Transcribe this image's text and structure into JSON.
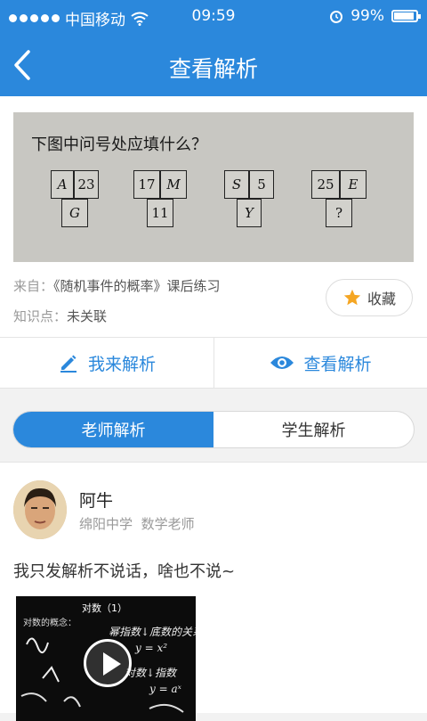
{
  "status": {
    "carrier": "中国移动",
    "time": "09:59",
    "battery": "99%"
  },
  "header": {
    "title": "查看解析"
  },
  "question": {
    "prompt": "下图中问号处应填什么？",
    "puzzles": [
      {
        "tl": "A",
        "tr": "23",
        "b": "G"
      },
      {
        "tl": "17",
        "tr": "M",
        "b": "11"
      },
      {
        "tl": "S",
        "tr": "5",
        "b": "Y"
      },
      {
        "tl": "25",
        "tr": "E",
        "b": "?"
      }
    ],
    "source_label": "来自：",
    "source_value": "《随机事件的概率》课后练习",
    "knowledge_label": "知识点：",
    "knowledge_value": "未关联",
    "favorite_label": "收藏"
  },
  "actions": {
    "my_analysis": "我来解析",
    "view_analysis": "查看解析"
  },
  "tabs": {
    "teacher": "老师解析",
    "student": "学生解析"
  },
  "answer": {
    "name": "阿牛",
    "school": "绵阳中学",
    "role": "数学老师",
    "text": "我只发解析不说话，啥也不说~",
    "video": {
      "title": "对数（1）",
      "concept": "对数的概念：",
      "line1": "幂指数↓底数的关系",
      "line2": "y = x²",
      "line3": "对数↓指数",
      "line4": "y = aˣ"
    }
  },
  "colors": {
    "accent": "#2b88dc",
    "star": "#f5a623"
  }
}
